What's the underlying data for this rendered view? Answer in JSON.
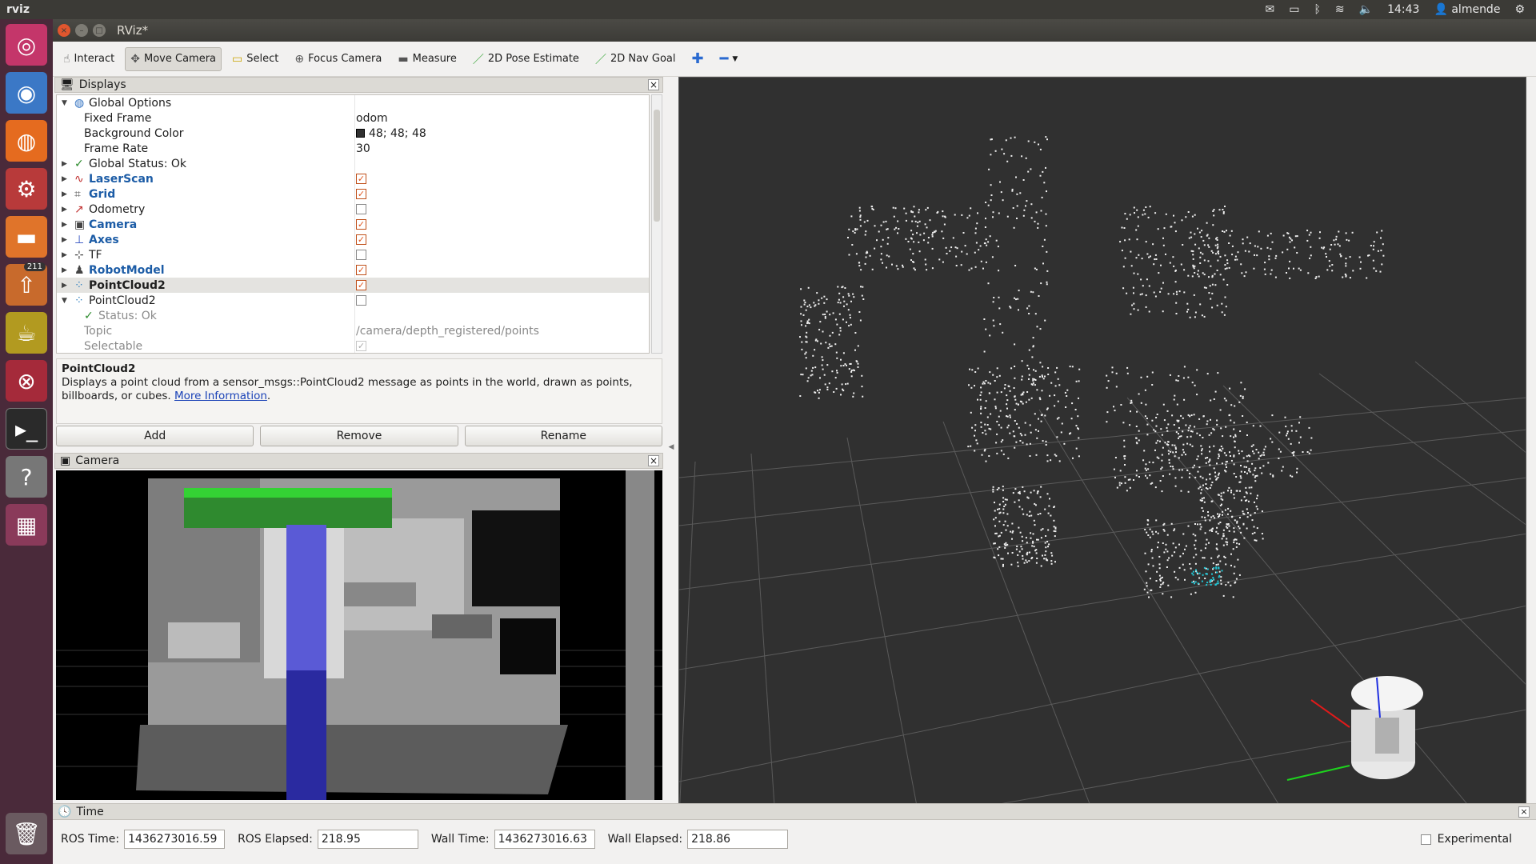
{
  "topbar": {
    "app_name": "rviz",
    "time": "14:43",
    "user": "almende",
    "icons": [
      "mail-icon",
      "battery-icon",
      "bluetooth-icon",
      "wifi-icon",
      "volume-icon",
      "settings-icon"
    ]
  },
  "launcher": {
    "items": [
      "ubuntu-dash",
      "chrome",
      "firefox",
      "system-settings",
      "files",
      "software-updater",
      "rviz-teapot",
      "ros-app",
      "terminal",
      "help",
      "workspace-switcher",
      "trash"
    ],
    "badge": "211"
  },
  "window": {
    "title": "RViz*"
  },
  "toolbar": {
    "tools": [
      {
        "label": "Interact",
        "icon": "interact-icon",
        "active": false
      },
      {
        "label": "Move Camera",
        "icon": "move-camera-icon",
        "active": true
      },
      {
        "label": "Select",
        "icon": "select-icon",
        "active": false
      },
      {
        "label": "Focus Camera",
        "icon": "focus-camera-icon",
        "active": false
      },
      {
        "label": "Measure",
        "icon": "measure-icon",
        "active": false
      },
      {
        "label": "2D Pose Estimate",
        "icon": "pose-estimate-icon",
        "active": false
      },
      {
        "label": "2D Nav Goal",
        "icon": "nav-goal-icon",
        "active": false
      }
    ]
  },
  "displays_panel": {
    "title": "Displays",
    "rows": [
      {
        "name": "Global Options",
        "indent": 0,
        "expanded": true,
        "icon": "globe-icon",
        "style": "normal",
        "value": ""
      },
      {
        "name": "Fixed Frame",
        "indent": 1,
        "style": "normal",
        "value": "odom"
      },
      {
        "name": "Background Color",
        "indent": 1,
        "style": "normal",
        "value": "48; 48; 48",
        "swatch": "#303030"
      },
      {
        "name": "Frame Rate",
        "indent": 1,
        "style": "normal",
        "value": "30"
      },
      {
        "name": "Global Status: Ok",
        "indent": 0,
        "expanded": false,
        "icon": "checkmark-icon",
        "style": "normal",
        "value": ""
      },
      {
        "name": "LaserScan",
        "indent": 0,
        "expanded": false,
        "icon": "laserscan-icon",
        "style": "blue",
        "checkbox": "on"
      },
      {
        "name": "Grid",
        "indent": 0,
        "expanded": false,
        "icon": "grid-icon",
        "style": "blue",
        "checkbox": "on"
      },
      {
        "name": "Odometry",
        "indent": 0,
        "expanded": false,
        "icon": "odometry-icon",
        "style": "normal",
        "checkbox": "off"
      },
      {
        "name": "Camera",
        "indent": 0,
        "expanded": false,
        "icon": "camera-icon",
        "style": "blue",
        "checkbox": "on"
      },
      {
        "name": "Axes",
        "indent": 0,
        "expanded": false,
        "icon": "axes-icon",
        "style": "blue",
        "checkbox": "on"
      },
      {
        "name": "TF",
        "indent": 0,
        "expanded": false,
        "icon": "tf-icon",
        "style": "normal",
        "checkbox": "off"
      },
      {
        "name": "RobotModel",
        "indent": 0,
        "expanded": false,
        "icon": "robot-model-icon",
        "style": "blue",
        "checkbox": "on"
      },
      {
        "name": "PointCloud2",
        "indent": 0,
        "expanded": false,
        "icon": "pointcloud-icon",
        "style": "bold",
        "checkbox": "on",
        "selected": true
      },
      {
        "name": "PointCloud2",
        "indent": 0,
        "expanded": true,
        "icon": "pointcloud-icon",
        "style": "normal",
        "checkbox": "off"
      },
      {
        "name": "Status: Ok",
        "indent": 1,
        "icon": "checkmark-icon",
        "style": "muted",
        "value": ""
      },
      {
        "name": "Topic",
        "indent": 1,
        "style": "muted",
        "value": "/camera/depth_registered/points"
      },
      {
        "name": "Selectable",
        "indent": 1,
        "style": "muted",
        "checkbox": "disabled"
      }
    ]
  },
  "description": {
    "title": "PointCloud2",
    "text": "Displays a point cloud from a sensor_msgs::PointCloud2 message as points in the world, drawn as points, billboards, or cubes.",
    "link": "More Information",
    "tail": "."
  },
  "buttons": {
    "add": "Add",
    "remove": "Remove",
    "rename": "Rename"
  },
  "camera_panel": {
    "title": "Camera"
  },
  "time_panel": {
    "title": "Time",
    "ros_time_label": "ROS Time:",
    "ros_time": "1436273016.59",
    "ros_elapsed_label": "ROS Elapsed:",
    "ros_elapsed": "218.95",
    "wall_time_label": "Wall Time:",
    "wall_time": "1436273016.63",
    "wall_elapsed_label": "Wall Elapsed:",
    "wall_elapsed": "218.86",
    "experimental_label": "Experimental"
  },
  "colors": {
    "accent_orange": "#e0561e",
    "link_blue": "#1c5ca6",
    "viewport_bg": "#303030",
    "launcher_bg": "#4a2a3a"
  }
}
